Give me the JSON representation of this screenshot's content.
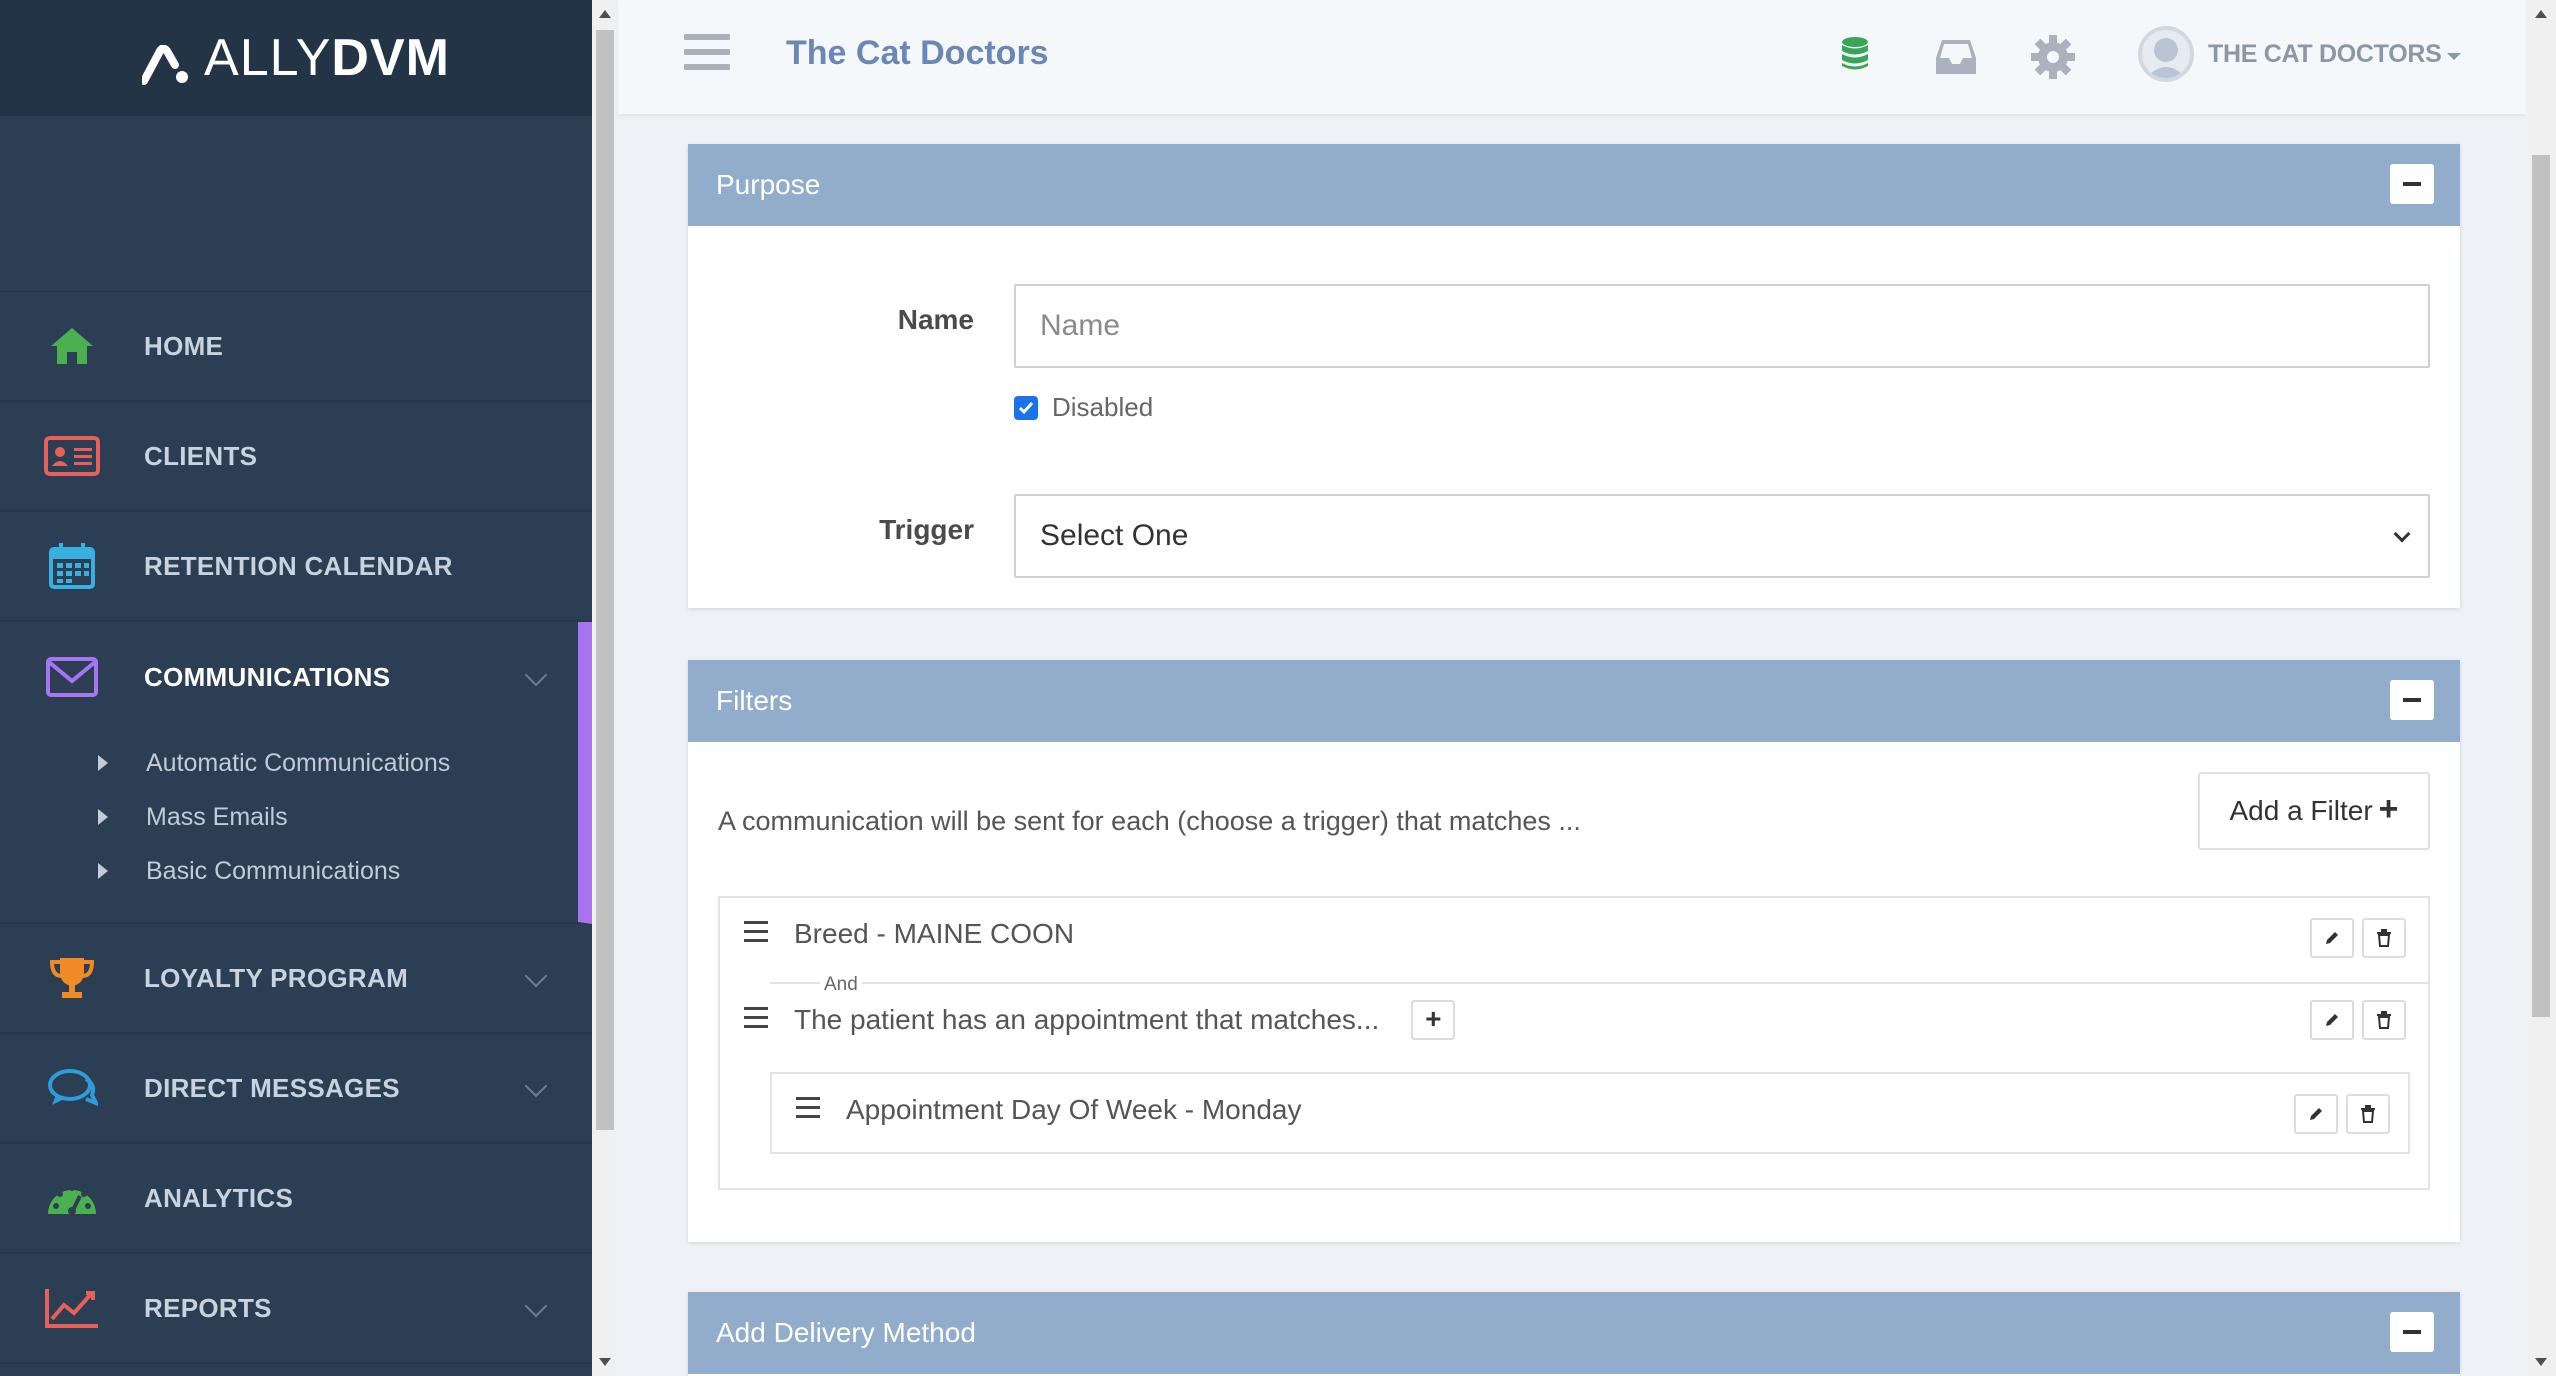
{
  "brand": {
    "light": "ALLY",
    "bold": "DVM"
  },
  "colors": {
    "sidebar": "#2c3e54",
    "accent_purple": "#a974f0",
    "panel_header": "#92adcb",
    "title_blue": "#6b88b4"
  },
  "sidebar": {
    "items": [
      {
        "label": "HOME",
        "icon": "home-icon",
        "color": "#4caf50"
      },
      {
        "label": "CLIENTS",
        "icon": "id-card-icon",
        "color": "#e8605a"
      },
      {
        "label": "RETENTION CALENDAR",
        "icon": "calendar-icon",
        "color": "#3ab0e0"
      },
      {
        "label": "COMMUNICATIONS",
        "icon": "envelope-icon",
        "color": "#a974f0"
      },
      {
        "label": "LOYALTY PROGRAM",
        "icon": "trophy-icon",
        "color": "#f08a24"
      },
      {
        "label": "DIRECT MESSAGES",
        "icon": "chat-icon",
        "color": "#2d9cdb"
      },
      {
        "label": "ANALYTICS",
        "icon": "gauge-icon",
        "color": "#4caf50"
      },
      {
        "label": "REPORTS",
        "icon": "line-chart-icon",
        "color": "#e8605a"
      }
    ],
    "sub_items": [
      {
        "label": "Automatic Communications"
      },
      {
        "label": "Mass Emails"
      },
      {
        "label": "Basic Communications"
      }
    ]
  },
  "topbar": {
    "title": "The Cat Doctors",
    "account": "THE CAT DOCTORS",
    "icons": [
      "database-icon",
      "inbox-icon",
      "gear-icon"
    ]
  },
  "purpose": {
    "header": "Purpose",
    "name_label": "Name",
    "name_placeholder": "Name",
    "name_value": "",
    "disabled_label": "Disabled",
    "disabled_checked": true,
    "trigger_label": "Trigger",
    "trigger_value": "Select One"
  },
  "filters": {
    "header": "Filters",
    "description": "A communication will be sent for each (choose a trigger) that matches ...",
    "add_button": "Add a Filter",
    "rows": [
      {
        "text": "Breed - MAINE COON"
      },
      {
        "text": "The patient has an appointment that matches..."
      }
    ],
    "connector": "And",
    "nested": {
      "text": "Appointment Day Of Week - Monday"
    }
  },
  "delivery": {
    "header": "Add Delivery Method"
  }
}
